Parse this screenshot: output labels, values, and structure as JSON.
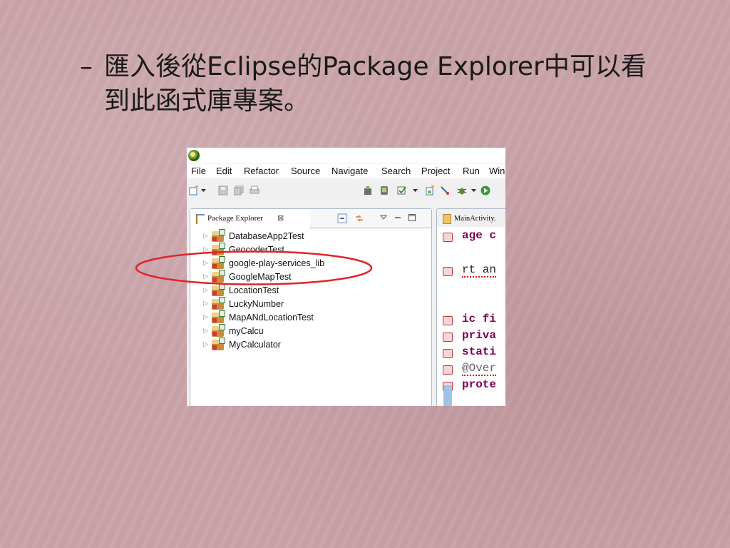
{
  "slide": {
    "dash": "–",
    "bullet_text": "匯入後從Eclipse的Package Explorer中可以看到此函式庫專案。"
  },
  "eclipse": {
    "menu": [
      "File",
      "Edit",
      "Refactor",
      "Source",
      "Navigate",
      "Search",
      "Project",
      "Run",
      "Win"
    ],
    "package_explorer": {
      "tab_label": "Package Explorer",
      "close_glyph": "⊠",
      "projects": [
        "DatabaseApp2Test",
        "GeocoderTest",
        "google-play-services_lib",
        "GoogleMapTest",
        "LocationTest",
        "LuckyNumber",
        "MapANdLocationTest",
        "myCalcu",
        "MyCalculator"
      ],
      "highlighted_project": "google-play-services_lib"
    },
    "editor": {
      "tab_label": "MainActivity.",
      "lines": [
        "age c",
        "rt an",
        "ic fi",
        "priva",
        "stati",
        "@Over",
        "prote"
      ]
    }
  },
  "colors": {
    "highlight_ellipse": "#e0242b",
    "slide_background": "#c9a3a8",
    "java_keyword": "#7f0055"
  }
}
